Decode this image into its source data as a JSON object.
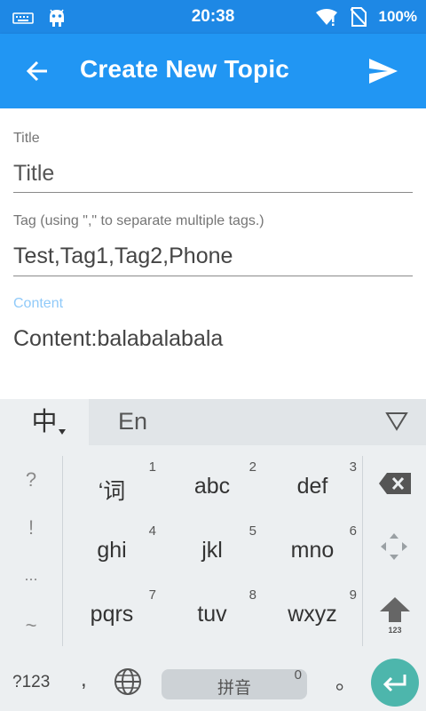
{
  "status_bar": {
    "time": "20:38",
    "battery": "100%"
  },
  "app_bar": {
    "title": "Create New Topic"
  },
  "form": {
    "title_label": "Title",
    "title_value": "Title",
    "tag_label": "Tag (using \",\" to separate multiple tags.)",
    "tag_value": "Test,Tag1,Tag2,Phone",
    "content_label": "Content",
    "content_value": "Content:balabalabala"
  },
  "keyboard": {
    "tab_cn": "中",
    "tab_en": "En",
    "side_left": [
      "?",
      "!",
      "...",
      "~"
    ],
    "keys": [
      {
        "main": "‘词",
        "num": "1"
      },
      {
        "main": "abc",
        "num": "2"
      },
      {
        "main": "def",
        "num": "3"
      },
      {
        "main": "ghi",
        "num": "4"
      },
      {
        "main": "jkl",
        "num": "5"
      },
      {
        "main": "mno",
        "num": "6"
      },
      {
        "main": "pqrs",
        "num": "7"
      },
      {
        "main": "tuv",
        "num": "8"
      },
      {
        "main": "wxyz",
        "num": "9"
      }
    ],
    "shift_label": "123",
    "num_mode": "?123",
    "comma": ",",
    "space_label": "拼音",
    "space_num": "0",
    "period": "。"
  },
  "colors": {
    "status_bar": "#1E88E5",
    "app_bar": "#2196F3",
    "accent_label": "#90CAF9",
    "enter": "#4DB6AC",
    "keyboard_bg": "#ECEFF1"
  },
  "icons": {
    "back": "arrow-left-icon",
    "send": "send-icon",
    "delete": "backspace-icon",
    "move": "cursor-move-icon",
    "shift": "shift-up-icon",
    "globe": "globe-icon",
    "enter": "enter-icon",
    "collapse": "collapse-triangle-icon"
  }
}
